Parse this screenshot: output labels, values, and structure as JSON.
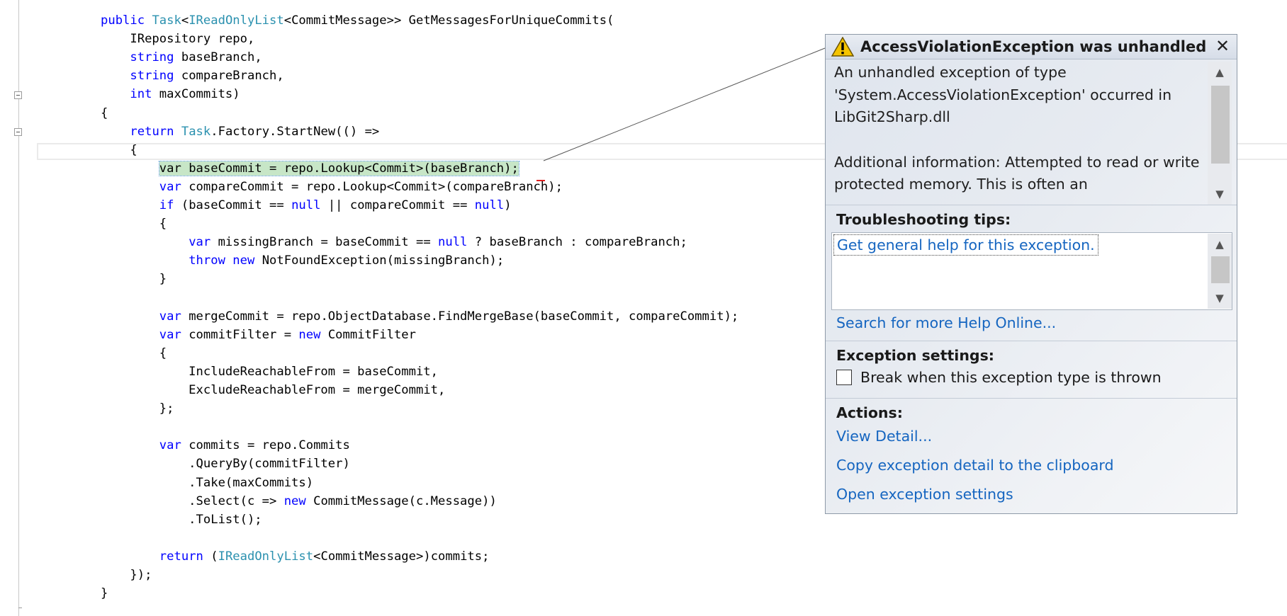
{
  "code": {
    "lines": [
      [
        {
          "t": "public ",
          "c": "kw"
        },
        {
          "t": "Task",
          "c": "ty"
        },
        {
          "t": "<"
        },
        {
          "t": "IReadOnlyList",
          "c": "ty"
        },
        {
          "t": "<CommitMessage>> GetMessagesForUniqueCommits("
        }
      ],
      [
        {
          "t": "    IRepository repo,"
        }
      ],
      [
        {
          "t": "    "
        },
        {
          "t": "string",
          "c": "kw"
        },
        {
          "t": " baseBranch,"
        }
      ],
      [
        {
          "t": "    "
        },
        {
          "t": "string",
          "c": "kw"
        },
        {
          "t": " compareBranch,"
        }
      ],
      [
        {
          "t": "    "
        },
        {
          "t": "int",
          "c": "kw"
        },
        {
          "t": " maxCommits)"
        }
      ],
      [
        {
          "t": "{"
        }
      ],
      [
        {
          "t": "    "
        },
        {
          "t": "return",
          "c": "kw"
        },
        {
          "t": " "
        },
        {
          "t": "Task",
          "c": "ty"
        },
        {
          "t": ".Factory.StartNew(() =>"
        }
      ],
      [
        {
          "t": "    {"
        }
      ],
      [
        {
          "t": "        "
        },
        {
          "t": "var baseCommit = repo.Lookup<Commit>(baseBranch);",
          "c": "hl"
        }
      ],
      [
        {
          "t": "        "
        },
        {
          "t": "var",
          "c": "kw"
        },
        {
          "t": " compareCommit = repo.Lookup<Commit>(compareBranch);"
        }
      ],
      [
        {
          "t": "        "
        },
        {
          "t": "if",
          "c": "kw"
        },
        {
          "t": " (baseCommit == "
        },
        {
          "t": "null",
          "c": "kw"
        },
        {
          "t": " || compareCommit == "
        },
        {
          "t": "null",
          "c": "kw"
        },
        {
          "t": ")"
        }
      ],
      [
        {
          "t": "        {"
        }
      ],
      [
        {
          "t": "            "
        },
        {
          "t": "var",
          "c": "kw"
        },
        {
          "t": " missingBranch = baseCommit == "
        },
        {
          "t": "null",
          "c": "kw"
        },
        {
          "t": " ? baseBranch : compareBranch;"
        }
      ],
      [
        {
          "t": "            "
        },
        {
          "t": "throw",
          "c": "kw"
        },
        {
          "t": " "
        },
        {
          "t": "new",
          "c": "kw"
        },
        {
          "t": " NotFoundException(missingBranch);"
        }
      ],
      [
        {
          "t": "        }"
        }
      ],
      [
        {
          "t": ""
        }
      ],
      [
        {
          "t": "        "
        },
        {
          "t": "var",
          "c": "kw"
        },
        {
          "t": " mergeCommit = repo.ObjectDatabase.FindMergeBase(baseCommit, compareCommit);"
        }
      ],
      [
        {
          "t": "        "
        },
        {
          "t": "var",
          "c": "kw"
        },
        {
          "t": " commitFilter = "
        },
        {
          "t": "new",
          "c": "kw"
        },
        {
          "t": " CommitFilter"
        }
      ],
      [
        {
          "t": "        {"
        }
      ],
      [
        {
          "t": "            IncludeReachableFrom = baseCommit,"
        }
      ],
      [
        {
          "t": "            ExcludeReachableFrom = mergeCommit,"
        }
      ],
      [
        {
          "t": "        };"
        }
      ],
      [
        {
          "t": ""
        }
      ],
      [
        {
          "t": "        "
        },
        {
          "t": "var",
          "c": "kw"
        },
        {
          "t": " commits = repo.Commits"
        }
      ],
      [
        {
          "t": "            .QueryBy(commitFilter)"
        }
      ],
      [
        {
          "t": "            .Take(maxCommits)"
        }
      ],
      [
        {
          "t": "            .Select(c => "
        },
        {
          "t": "new",
          "c": "kw"
        },
        {
          "t": " CommitMessage(c.Message))"
        }
      ],
      [
        {
          "t": "            .ToList();"
        }
      ],
      [
        {
          "t": ""
        }
      ],
      [
        {
          "t": "        "
        },
        {
          "t": "return",
          "c": "kw"
        },
        {
          "t": " ("
        },
        {
          "t": "IReadOnlyList",
          "c": "ty"
        },
        {
          "t": "<CommitMessage>)commits;"
        }
      ],
      [
        {
          "t": "    });"
        }
      ],
      [
        {
          "t": "}"
        }
      ]
    ]
  },
  "popup": {
    "title": "AccessViolationException was unhandled",
    "warning_icon": "warning-triangle-icon",
    "close_glyph": "✕",
    "message_1": "An unhandled exception of type 'System.AccessViolationException' occurred in LibGit2Sharp.dll",
    "message_2": "Additional information: Attempted to read or write protected memory. This is often an",
    "troubleshooting_title": "Troubleshooting tips:",
    "troubleshooting_link": "Get general help for this exception.",
    "search_link": "Search for more Help Online...",
    "exception_settings_title": "Exception settings:",
    "break_checkbox_label": "Break when this exception type is thrown",
    "break_checked": false,
    "actions_title": "Actions:",
    "action_view_detail": "View Detail...",
    "action_copy": "Copy exception detail to the clipboard",
    "action_open_settings": "Open exception settings"
  },
  "colors": {
    "keyword": "#0000ff",
    "type": "#2b91af",
    "highlight": "#c7e6c7",
    "link": "#1565c0"
  }
}
